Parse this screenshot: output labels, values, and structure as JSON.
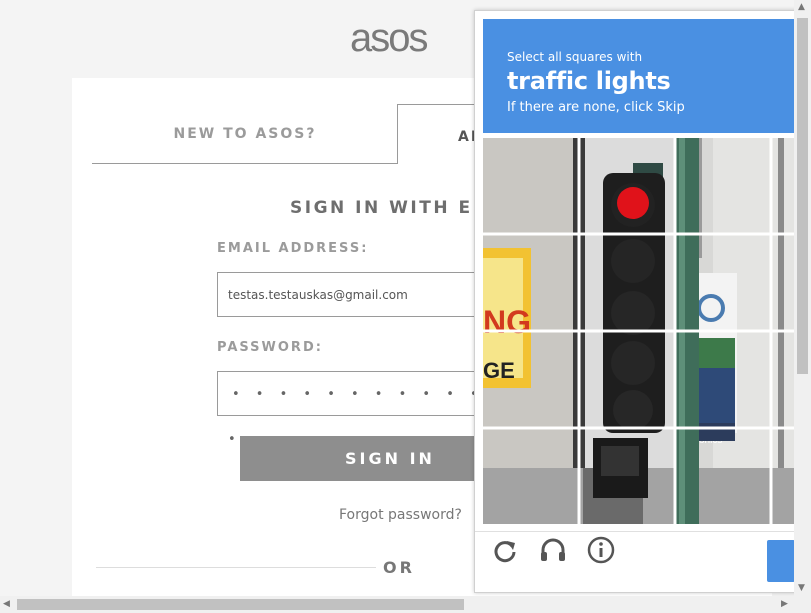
{
  "site": {
    "logo": "asos"
  },
  "tabs": {
    "new": "NEW TO ASOS?",
    "already": "AL"
  },
  "form": {
    "heading": "SIGN IN WITH EMA",
    "email_label": "EMAIL ADDRESS:",
    "email_value": "testas.testauskas@gmail.com",
    "password_label": "PASSWORD:",
    "password_mask": "• • • • • • • • • • • • • • • • • • •",
    "signin_label": "SIGN IN",
    "forgot_label": "Forgot password?",
    "or_label": "OR"
  },
  "captcha": {
    "instruction_line1": "Select all squares with",
    "target": "traffic lights",
    "instruction_line3": "If there are none, click Skip",
    "icons": [
      "reload-icon",
      "audio-icon",
      "info-icon"
    ],
    "accent": "#4a90e2"
  }
}
